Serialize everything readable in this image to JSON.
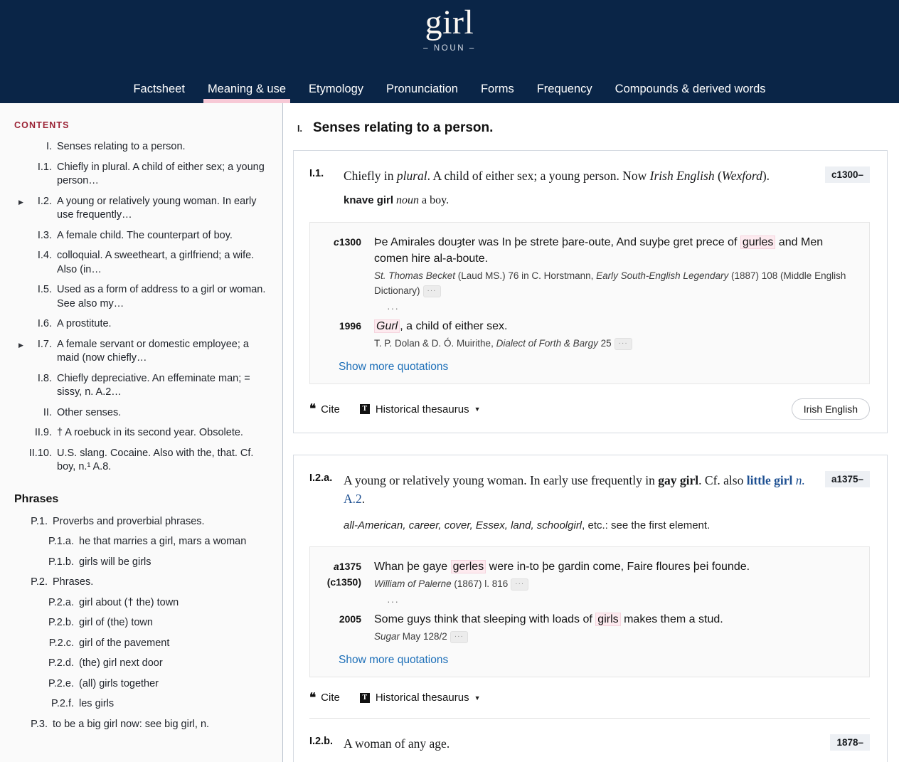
{
  "header": {
    "headword": "girl",
    "pos": "– NOUN –",
    "nav": [
      {
        "label": "Factsheet",
        "active": false
      },
      {
        "label": "Meaning & use",
        "active": true
      },
      {
        "label": "Etymology",
        "active": false
      },
      {
        "label": "Pronunciation",
        "active": false
      },
      {
        "label": "Forms",
        "active": false
      },
      {
        "label": "Frequency",
        "active": false
      },
      {
        "label": "Compounds & derived words",
        "active": false
      }
    ]
  },
  "sidebar": {
    "contents_label": "CONTENTS",
    "phrases_label": "Phrases",
    "items": [
      {
        "num": "I.",
        "text": "Senses relating to a person.",
        "arrow": false,
        "level": 1
      },
      {
        "num": "I.1.",
        "text": "Chiefly in plural. A child of either sex; a young person…",
        "arrow": false,
        "level": 2
      },
      {
        "num": "I.2.",
        "text": "A young or relatively young woman. In early use frequently…",
        "arrow": true,
        "level": 2
      },
      {
        "num": "I.3.",
        "text": "A female child. The counterpart of boy.",
        "arrow": false,
        "level": 2
      },
      {
        "num": "I.4.",
        "text": "colloquial. A sweetheart, a girlfriend; a wife. Also (in…",
        "arrow": false,
        "level": 2
      },
      {
        "num": "I.5.",
        "text": "Used as a form of address to a girl or woman. See also my…",
        "arrow": false,
        "level": 2
      },
      {
        "num": "I.6.",
        "text": "A prostitute.",
        "arrow": false,
        "level": 2
      },
      {
        "num": "I.7.",
        "text": "A female servant or domestic employee; a maid (now chiefly…",
        "arrow": true,
        "level": 2
      },
      {
        "num": "I.8.",
        "text": "Chiefly depreciative. An effeminate man; = sissy, n. A.2…",
        "arrow": false,
        "level": 2
      },
      {
        "num": "II.",
        "text": "Other senses.",
        "arrow": false,
        "level": 1
      },
      {
        "num": "II.9.",
        "text": "† A roebuck in its second year. Obsolete.",
        "arrow": false,
        "level": 2
      },
      {
        "num": "II.10.",
        "text": "U.S. slang. Cocaine. Also with the, that. Cf. boy, n.¹ A.8.",
        "arrow": false,
        "level": 2
      }
    ],
    "phrases": [
      {
        "num": "P.1.",
        "text": "Proverbs and proverbial phrases.",
        "level": 1
      },
      {
        "num": "P.1.a.",
        "text": "he that marries a girl, mars a woman",
        "level": 2
      },
      {
        "num": "P.1.b.",
        "text": "girls will be girls",
        "level": 2
      },
      {
        "num": "P.2.",
        "text": "Phrases.",
        "level": 1
      },
      {
        "num": "P.2.a.",
        "text": "girl about († the) town",
        "level": 2
      },
      {
        "num": "P.2.b.",
        "text": "girl of (the) town",
        "level": 2
      },
      {
        "num": "P.2.c.",
        "text": "girl of the pavement",
        "level": 2
      },
      {
        "num": "P.2.d.",
        "text": "(the) girl next door",
        "level": 2
      },
      {
        "num": "P.2.e.",
        "text": "(all) girls together",
        "level": 2
      },
      {
        "num": "P.2.f.",
        "text": "les girls",
        "level": 2
      },
      {
        "num": "P.3.",
        "text": "to be a big girl now: see big girl, n.",
        "level": 1
      }
    ]
  },
  "main": {
    "section": {
      "numeral": "I.",
      "title": "Senses relating to a person."
    },
    "senses": [
      {
        "id": "I.1.",
        "date_badge": "c1300–",
        "def_parts": [
          {
            "t": "Chiefly in ",
            "s": "plain"
          },
          {
            "t": "plural",
            "s": "italic"
          },
          {
            "t": ". A child of either sex; a young person. Now ",
            "s": "plain"
          },
          {
            "t": "Irish English",
            "s": "italic"
          },
          {
            "t": " (",
            "s": "plain"
          },
          {
            "t": "Wexford",
            "s": "italic"
          },
          {
            "t": ").",
            "s": "plain"
          }
        ],
        "subdef": {
          "head": "knave girl",
          "pos": "noun",
          "gloss": " a boy."
        },
        "combnote": "",
        "quotes": [
          {
            "date": "c1300",
            "date_sub": "",
            "text_parts": [
              {
                "t": "Þe Amirales douȝter was In þe strete þare-oute, And suyþe gret prece of ",
                "s": "plain"
              },
              {
                "t": "gurles",
                "s": "hl"
              },
              {
                "t": " and Men comen hire al-a-boute.",
                "s": "plain"
              }
            ],
            "source_parts": [
              {
                "t": "St. Thomas Becket",
                "s": "italic"
              },
              {
                "t": " (Laud MS.) 76 in C. Horstmann, ",
                "s": "plain"
              },
              {
                "t": "Early South-English Legendary",
                "s": "italic"
              },
              {
                "t": " (1887) 108 (Middle English Dictionary)",
                "s": "plain"
              }
            ],
            "has_dots": true,
            "gap_after": true
          },
          {
            "date": "1996",
            "date_sub": "",
            "text_parts": [
              {
                "t": "Gurl",
                "s": "hl-italic"
              },
              {
                "t": ", a child of either sex.",
                "s": "plain"
              }
            ],
            "source_parts": [
              {
                "t": "T. P. Dolan & D. Ó. Muirithe, ",
                "s": "plain"
              },
              {
                "t": "Dialect of Forth & Bargy",
                "s": "italic"
              },
              {
                "t": " 25",
                "s": "plain"
              }
            ],
            "has_dots": true,
            "gap_after": false
          }
        ],
        "show_more": "Show more quotations",
        "actions": {
          "cite": "Cite",
          "thesaurus": "Historical thesaurus",
          "thes_icon": "T",
          "region_pill": "Irish English"
        }
      },
      {
        "id": "I.2.a.",
        "date_badge": "a1375–",
        "def_parts": [
          {
            "t": "A young or relatively young woman. In early use frequently in ",
            "s": "plain"
          },
          {
            "t": "gay girl",
            "s": "bold"
          },
          {
            "t": ". Cf. also ",
            "s": "plain"
          },
          {
            "t": "little girl",
            "s": "xref"
          },
          {
            "t": " n.",
            "s": "xref-it"
          },
          {
            "t": " A.2",
            "s": "xref-plain"
          },
          {
            "t": ".",
            "s": "plain"
          }
        ],
        "subdef": null,
        "combnote_parts": [
          {
            "t": "all-American, career, cover, Essex, land, schoolgirl",
            "s": "italic"
          },
          {
            "t": ", etc.: see the first element.",
            "s": "plain"
          }
        ],
        "quotes": [
          {
            "date": "a1375",
            "date_sub": "(c1350)",
            "text_parts": [
              {
                "t": "Whan þe gaye ",
                "s": "plain"
              },
              {
                "t": "gerles",
                "s": "hl"
              },
              {
                "t": " were in-to þe gardin come, Faire floures þei founde.",
                "s": "plain"
              }
            ],
            "source_parts": [
              {
                "t": "William of Palerne",
                "s": "italic"
              },
              {
                "t": " (1867) l. 816",
                "s": "plain"
              }
            ],
            "has_dots": true,
            "gap_after": true
          },
          {
            "date": "2005",
            "date_sub": "",
            "text_parts": [
              {
                "t": "Some guys think that sleeping with loads of ",
                "s": "plain"
              },
              {
                "t": "girls",
                "s": "hl"
              },
              {
                "t": " makes them a stud.",
                "s": "plain"
              }
            ],
            "source_parts": [
              {
                "t": "Sugar",
                "s": "italic"
              },
              {
                "t": " May 128/2",
                "s": "plain"
              }
            ],
            "has_dots": true,
            "gap_after": false
          }
        ],
        "show_more": "Show more quotations",
        "actions": {
          "cite": "Cite",
          "thesaurus": "Historical thesaurus",
          "thes_icon": "T",
          "region_pill": ""
        }
      },
      {
        "id": "I.2.b.",
        "date_badge": "1878–",
        "def_parts": [
          {
            "t": "A woman of any age.",
            "s": "plain"
          }
        ],
        "subdef": null,
        "quotes": [],
        "show_more": "",
        "actions": null
      }
    ]
  },
  "colors": {
    "navy": "#0a2547",
    "pink_underline": "#f7c9d6",
    "contents_red": "#9b2335",
    "link_blue": "#1d6fb8",
    "xref_blue": "#1d4f91",
    "highlight_pink": "#fdeaef",
    "badge_bg": "#edf0f4"
  }
}
